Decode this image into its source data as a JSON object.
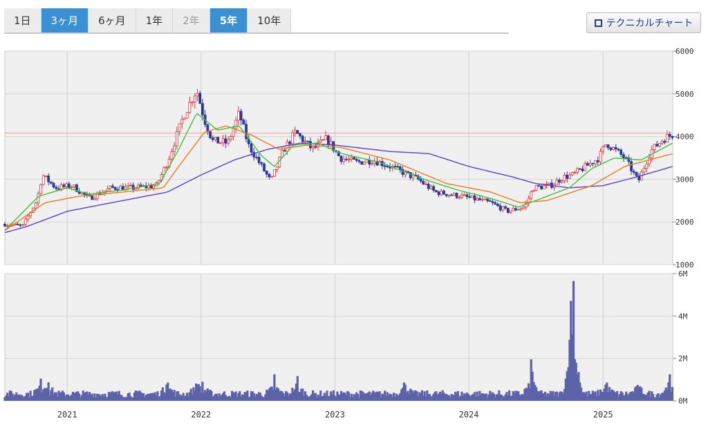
{
  "tabs": [
    {
      "label": "1日",
      "state": "normal"
    },
    {
      "label": "3ヶ月",
      "state": "active"
    },
    {
      "label": "6ヶ月",
      "state": "normal"
    },
    {
      "label": "1年",
      "state": "normal"
    },
    {
      "label": "2年",
      "state": "dim"
    },
    {
      "label": "5年",
      "state": "active-bold"
    },
    {
      "label": "10年",
      "state": "normal"
    }
  ],
  "technical_button": {
    "label": "テクニカルチャート",
    "icon": "window-icon"
  },
  "colors": {
    "up": "#e8333a",
    "down": "#2b3a96",
    "ma_short": "#3dc13d",
    "ma_mid": "#f07a1e",
    "ma_long": "#5b3fc6",
    "volume": "#5c62a8",
    "ref_line": "#f0a0a0"
  },
  "chart_data": {
    "type": "candlestick",
    "price_axis": {
      "ylim": [
        1000,
        6000
      ],
      "ticks": [
        "1000",
        "2000",
        "3000",
        "4000",
        "5000",
        "6000"
      ]
    },
    "volume_axis": {
      "ylim": [
        0,
        6000000
      ],
      "ticks": [
        "0M",
        "2M",
        "4M",
        "6M"
      ]
    },
    "x_axis": {
      "xlim": [
        "2020-07-15",
        "2025-07-10"
      ],
      "ticks": [
        "2021",
        "2022",
        "2023",
        "2024",
        "2025"
      ]
    },
    "reference_price": 4080,
    "grid": true,
    "price_anchors": [
      [
        "2020-07-15",
        1950
      ],
      [
        "2020-09-01",
        1900
      ],
      [
        "2020-10-10",
        2500
      ],
      [
        "2020-10-25",
        3100
      ],
      [
        "2020-12-01",
        2800
      ],
      [
        "2021-01-15",
        2850
      ],
      [
        "2021-03-01",
        2550
      ],
      [
        "2021-05-01",
        2800
      ],
      [
        "2021-07-01",
        2800
      ],
      [
        "2021-09-01",
        2850
      ],
      [
        "2021-10-01",
        3400
      ],
      [
        "2021-11-15",
        4500
      ],
      [
        "2021-12-20",
        5100
      ],
      [
        "2022-01-10",
        4400
      ],
      [
        "2022-02-01",
        3900
      ],
      [
        "2022-03-15",
        3850
      ],
      [
        "2022-04-15",
        4550
      ],
      [
        "2022-05-10",
        3800
      ],
      [
        "2022-06-15",
        3300
      ],
      [
        "2022-07-10",
        2950
      ],
      [
        "2022-08-15",
        3700
      ],
      [
        "2022-09-15",
        4100
      ],
      [
        "2022-11-01",
        3700
      ],
      [
        "2022-12-10",
        3950
      ],
      [
        "2023-01-15",
        3500
      ],
      [
        "2023-03-01",
        3400
      ],
      [
        "2023-04-15",
        3450
      ],
      [
        "2023-06-01",
        3300
      ],
      [
        "2023-08-15",
        3000
      ],
      [
        "2023-10-01",
        2700
      ],
      [
        "2023-12-15",
        2600
      ],
      [
        "2024-03-01",
        2450
      ],
      [
        "2024-04-15",
        2250
      ],
      [
        "2024-06-01",
        2350
      ],
      [
        "2024-06-25",
        2800
      ],
      [
        "2024-08-10",
        2850
      ],
      [
        "2024-09-15",
        3050
      ],
      [
        "2024-10-10",
        3100
      ],
      [
        "2024-11-15",
        3300
      ],
      [
        "2024-12-20",
        3500
      ],
      [
        "2025-01-10",
        3850
      ],
      [
        "2025-03-01",
        3500
      ],
      [
        "2025-04-07",
        2950
      ],
      [
        "2025-05-10",
        3650
      ],
      [
        "2025-06-15",
        3950
      ],
      [
        "2025-07-10",
        4050
      ]
    ],
    "ma_short_anchors": [
      [
        "2020-07-15",
        1800
      ],
      [
        "2020-10-15",
        2600
      ],
      [
        "2021-01-01",
        2800
      ],
      [
        "2021-03-01",
        2650
      ],
      [
        "2021-06-01",
        2750
      ],
      [
        "2021-09-10",
        2900
      ],
      [
        "2021-11-01",
        3700
      ],
      [
        "2021-12-20",
        4550
      ],
      [
        "2022-02-15",
        4150
      ],
      [
        "2022-04-15",
        4250
      ],
      [
        "2022-06-15",
        3550
      ],
      [
        "2022-07-20",
        3300
      ],
      [
        "2022-09-10",
        3800
      ],
      [
        "2022-11-15",
        3850
      ],
      [
        "2023-01-20",
        3600
      ],
      [
        "2023-05-01",
        3400
      ],
      [
        "2023-09-01",
        3000
      ],
      [
        "2023-12-01",
        2750
      ],
      [
        "2024-03-01",
        2550
      ],
      [
        "2024-05-15",
        2350
      ],
      [
        "2024-07-01",
        2500
      ],
      [
        "2024-10-01",
        2800
      ],
      [
        "2024-12-01",
        3250
      ],
      [
        "2025-02-01",
        3500
      ],
      [
        "2025-04-15",
        3450
      ],
      [
        "2025-07-10",
        3850
      ]
    ],
    "ma_mid_anchors": [
      [
        "2020-07-15",
        1800
      ],
      [
        "2020-11-01",
        2450
      ],
      [
        "2021-02-01",
        2600
      ],
      [
        "2021-06-01",
        2700
      ],
      [
        "2021-09-20",
        2800
      ],
      [
        "2021-11-01",
        3300
      ],
      [
        "2022-01-10",
        4100
      ],
      [
        "2022-03-10",
        4250
      ],
      [
        "2022-05-15",
        4050
      ],
      [
        "2022-08-01",
        3700
      ],
      [
        "2022-10-15",
        3800
      ],
      [
        "2023-01-15",
        3750
      ],
      [
        "2023-06-01",
        3450
      ],
      [
        "2023-11-01",
        2900
      ],
      [
        "2024-03-01",
        2700
      ],
      [
        "2024-05-20",
        2450
      ],
      [
        "2024-08-01",
        2500
      ],
      [
        "2024-12-01",
        2850
      ],
      [
        "2025-03-01",
        3300
      ],
      [
        "2025-07-10",
        3600
      ]
    ],
    "ma_long_anchors": [
      [
        "2020-07-15",
        1750
      ],
      [
        "2020-09-15",
        1900
      ],
      [
        "2021-01-01",
        2250
      ],
      [
        "2021-06-01",
        2500
      ],
      [
        "2021-10-01",
        2700
      ],
      [
        "2022-01-01",
        3100
      ],
      [
        "2022-04-01",
        3450
      ],
      [
        "2022-07-01",
        3700
      ],
      [
        "2022-10-01",
        3850
      ],
      [
        "2023-01-01",
        3800
      ],
      [
        "2023-06-01",
        3650
      ],
      [
        "2023-09-15",
        3600
      ],
      [
        "2024-01-01",
        3300
      ],
      [
        "2024-05-01",
        3050
      ],
      [
        "2024-07-01",
        2900
      ],
      [
        "2024-10-01",
        2800
      ],
      [
        "2025-01-01",
        2850
      ],
      [
        "2025-04-01",
        3050
      ],
      [
        "2025-07-10",
        3300
      ]
    ],
    "volume_spikes": [
      [
        "2020-10-20",
        1200000
      ],
      [
        "2020-11-10",
        1050000
      ],
      [
        "2021-10-01",
        1150000
      ],
      [
        "2021-12-20",
        1000000
      ],
      [
        "2022-01-05",
        900000
      ],
      [
        "2022-07-20",
        1250000
      ],
      [
        "2022-09-20",
        1400000
      ],
      [
        "2023-07-10",
        1150000
      ],
      [
        "2024-06-20",
        2350000
      ],
      [
        "2024-10-05",
        3800000
      ],
      [
        "2024-10-12",
        5900000
      ],
      [
        "2024-10-20",
        1400000
      ],
      [
        "2025-01-10",
        1150000
      ],
      [
        "2025-04-07",
        1000000
      ],
      [
        "2025-07-01",
        1500000
      ]
    ]
  }
}
